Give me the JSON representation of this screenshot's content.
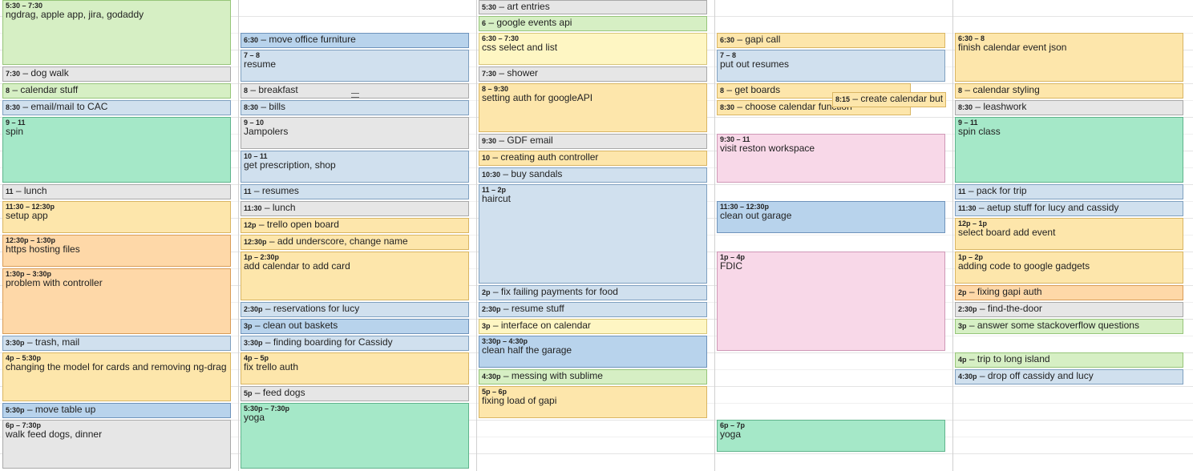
{
  "days": [
    {
      "events": [
        {
          "time": "5:30 – 7:30",
          "title": "ngdrag, apple app, jira, godaddy"
        },
        {
          "time": "7:30",
          "title": "dog walk"
        },
        {
          "time": "8",
          "title": "calendar stuff"
        },
        {
          "time": "8:30",
          "title": "email/mail to CAC"
        },
        {
          "time": "9 – 11",
          "title": "spin"
        },
        {
          "time": "11",
          "title": "lunch"
        },
        {
          "time": "11:30 – 12:30p",
          "title": "setup app"
        },
        {
          "time": "12:30p – 1:30p",
          "title": "https hosting files"
        },
        {
          "time": "1:30p – 3:30p",
          "title": "problem with controller"
        },
        {
          "time": "3:30p",
          "title": "trash, mail"
        },
        {
          "time": "4p – 5:30p",
          "title": "changing the model for cards and removing ng-drag"
        },
        {
          "time": "5:30p",
          "title": "move table up"
        },
        {
          "time": "6p – 7:30p",
          "title": "walk feed dogs, dinner"
        }
      ]
    },
    {
      "events": [
        {
          "time": "6:30",
          "title": "move office furniture"
        },
        {
          "time": "7 – 8",
          "title": "resume"
        },
        {
          "time": "8",
          "title": "breakfast"
        },
        {
          "time": "8:30",
          "title": "bills"
        },
        {
          "time": "9 – 10",
          "title": "Jampolers"
        },
        {
          "time": "10 – 11",
          "title": "get prescription, shop"
        },
        {
          "time": "11",
          "title": "resumes"
        },
        {
          "time": "11:30",
          "title": "lunch"
        },
        {
          "time": "12p",
          "title": "trello open board"
        },
        {
          "time": "12:30p",
          "title": "add underscore, change name"
        },
        {
          "time": "1p – 2:30p",
          "title": "add calendar to add card"
        },
        {
          "time": "2:30p",
          "title": "reservations for lucy"
        },
        {
          "time": "3p",
          "title": "clean out baskets"
        },
        {
          "time": "3:30p",
          "title": "finding boarding for Cassidy"
        },
        {
          "time": "4p – 5p",
          "title": "fix trello auth"
        },
        {
          "time": "5p",
          "title": "feed dogs"
        },
        {
          "time": "5:30p – 7:30p",
          "title": "yoga"
        }
      ]
    },
    {
      "events": [
        {
          "time": "5:30",
          "title": "art entries"
        },
        {
          "time": "6",
          "title": "google events api"
        },
        {
          "time": "6:30 – 7:30",
          "title": "css select and list"
        },
        {
          "time": "7:30",
          "title": "shower"
        },
        {
          "time": "8 – 9:30",
          "title": "setting auth for googleAPI"
        },
        {
          "time": "9:30",
          "title": "GDF email"
        },
        {
          "time": "10",
          "title": "creating auth controller"
        },
        {
          "time": "10:30",
          "title": "buy sandals"
        },
        {
          "time": "11 – 2p",
          "title": "haircut"
        },
        {
          "time": "2p",
          "title": "fix failing payments for food"
        },
        {
          "time": "2:30p",
          "title": "resume stuff"
        },
        {
          "time": "3p",
          "title": "interface on calendar"
        },
        {
          "time": "3:30p – 4:30p",
          "title": "clean half the garage"
        },
        {
          "time": "4:30p",
          "title": "messing with sublime"
        },
        {
          "time": "5p – 6p",
          "title": "fixing load of gapi"
        }
      ]
    },
    {
      "events": [
        {
          "time": "6:30",
          "title": "gapi call"
        },
        {
          "time": "7 – 8",
          "title": "put out resumes"
        },
        {
          "time": "8",
          "title": "get boards"
        },
        {
          "time": "8:15",
          "title": "create calendar but"
        },
        {
          "time": "8:30",
          "title": "choose calendar function"
        },
        {
          "time": "9:30 – 11",
          "title": "visit reston workspace"
        },
        {
          "time": "11:30 – 12:30p",
          "title": "clean out garage"
        },
        {
          "time": "1p – 4p",
          "title": "FDIC"
        },
        {
          "time": "6p – 7p",
          "title": "yoga"
        }
      ]
    },
    {
      "events": [
        {
          "time": "6:30 – 8",
          "title": "finish calendar event json"
        },
        {
          "time": "8",
          "title": "calendar styling"
        },
        {
          "time": "8:30",
          "title": "leashwork"
        },
        {
          "time": "9 – 11",
          "title": "spin class"
        },
        {
          "time": "11",
          "title": "pack for trip"
        },
        {
          "time": "11:30",
          "title": "aetup stuff for lucy and cassidy"
        },
        {
          "time": "12p – 1p",
          "title": "select board add event"
        },
        {
          "time": "1p – 2p",
          "title": "adding code to google gadgets"
        },
        {
          "time": "2p",
          "title": "fixing gapi auth"
        },
        {
          "time": "2:30p",
          "title": "find-the-door"
        },
        {
          "time": "3p",
          "title": "answer some stackoverflow questions"
        },
        {
          "time": "4p",
          "title": "trip to long island"
        },
        {
          "time": "4:30p",
          "title": "drop off cassidy and lucy"
        }
      ]
    }
  ]
}
